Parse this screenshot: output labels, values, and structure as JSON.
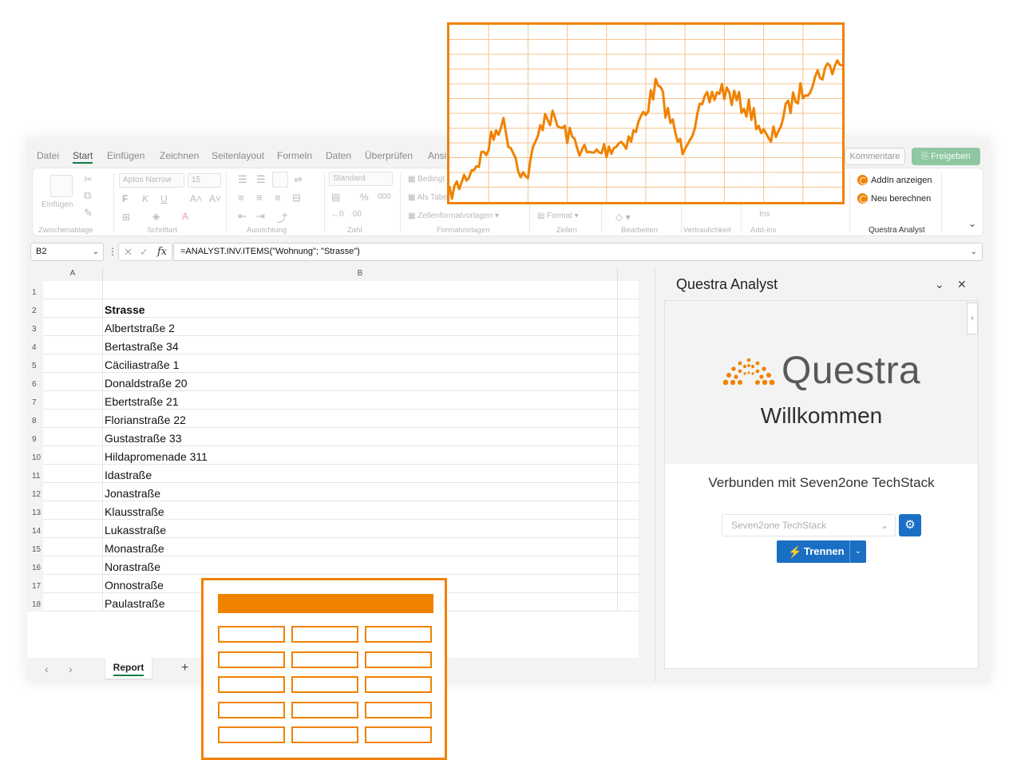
{
  "menu": {
    "tabs": [
      "Datei",
      "Start",
      "Einfügen",
      "Zeichnen",
      "Seitenlayout",
      "Formeln",
      "Daten",
      "Überprüfen",
      "Ansicht"
    ],
    "active_tab": "Start",
    "comments_label": "Kommentare",
    "share_label": "Freigeben"
  },
  "ribbon": {
    "paste_label": "Einfügen",
    "font_name": "Aptos Narrow",
    "font_size": "15",
    "number_format": "Standard",
    "conditional_label": "Bedingt",
    "as_table_label": "Als Tabe",
    "cell_styles_label": "Zellenformatvorlagen",
    "format_label": "Format",
    "ins_label": "Ins",
    "groups": [
      "Zwischenablage",
      "Schriftart",
      "Ausrichtung",
      "Zahl",
      "Formatvorlagen",
      "Zellen",
      "Bearbeiten",
      "Vertraulichkeit",
      "Add-ins"
    ],
    "questra": {
      "show_addin": "AddIn anzeigen",
      "recalc": "Neu berechnen",
      "group_label": "Questra Analyst"
    }
  },
  "formula_bar": {
    "name_box": "B2",
    "formula": "=ANALYST.INV.ITEMS(\"Wohnung\"; \"Strasse\")"
  },
  "sheet": {
    "columns": [
      "A",
      "B"
    ],
    "rows": [
      {
        "n": "1",
        "b": ""
      },
      {
        "n": "2",
        "b": "Strasse"
      },
      {
        "n": "3",
        "b": "Albertstraße 2"
      },
      {
        "n": "4",
        "b": "Bertastraße 34"
      },
      {
        "n": "5",
        "b": "Cäciliastraße 1"
      },
      {
        "n": "6",
        "b": "Donaldstraße 20"
      },
      {
        "n": "7",
        "b": "Ebertstraße 21"
      },
      {
        "n": "8",
        "b": "Florianstraße 22"
      },
      {
        "n": "9",
        "b": "Gustastraße 33"
      },
      {
        "n": "10",
        "b": "Hildapromenade 311"
      },
      {
        "n": "11",
        "b": "Idastraße"
      },
      {
        "n": "12",
        "b": "Jonastraße"
      },
      {
        "n": "13",
        "b": "Klausstraße"
      },
      {
        "n": "14",
        "b": "Lukasstraße"
      },
      {
        "n": "15",
        "b": "Monastraße"
      },
      {
        "n": "16",
        "b": "Norastraße"
      },
      {
        "n": "17",
        "b": "Onnostraße"
      },
      {
        "n": "18",
        "b": "Paulastraße"
      }
    ],
    "sheet_tab": "Report"
  },
  "task_pane": {
    "title": "Questra Analyst",
    "logo_text": "Questra",
    "welcome": "Willkommen",
    "connected_text": "Verbunden mit Seven2one TechStack",
    "select_value": "Seven2one TechStack",
    "disconnect_label": "Trennen"
  },
  "colors": {
    "accent_orange": "#f08200",
    "excel_green": "#107c41",
    "button_blue": "#1a6fc4"
  }
}
